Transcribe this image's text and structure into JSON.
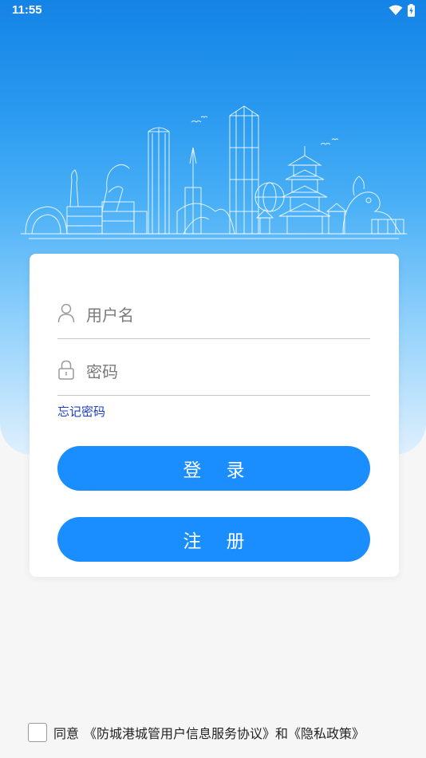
{
  "status_bar": {
    "time": "11:55",
    "icons": [
      "wifi-icon",
      "battery-charging-icon"
    ]
  },
  "login_form": {
    "username_placeholder": "用户名",
    "password_placeholder": "密码",
    "forgot_password": "忘记密码",
    "login_button": "登 录",
    "register_button": "注 册"
  },
  "agreement": {
    "prefix": "同意",
    "user_agreement": "《防城港城管用户信息服务协议》",
    "conjunction": "和",
    "privacy_policy": "《隐私政策》"
  },
  "colors": {
    "primary_button": "#1a8dff",
    "link": "#1a3fc4",
    "hero_top": "#1483e6"
  }
}
